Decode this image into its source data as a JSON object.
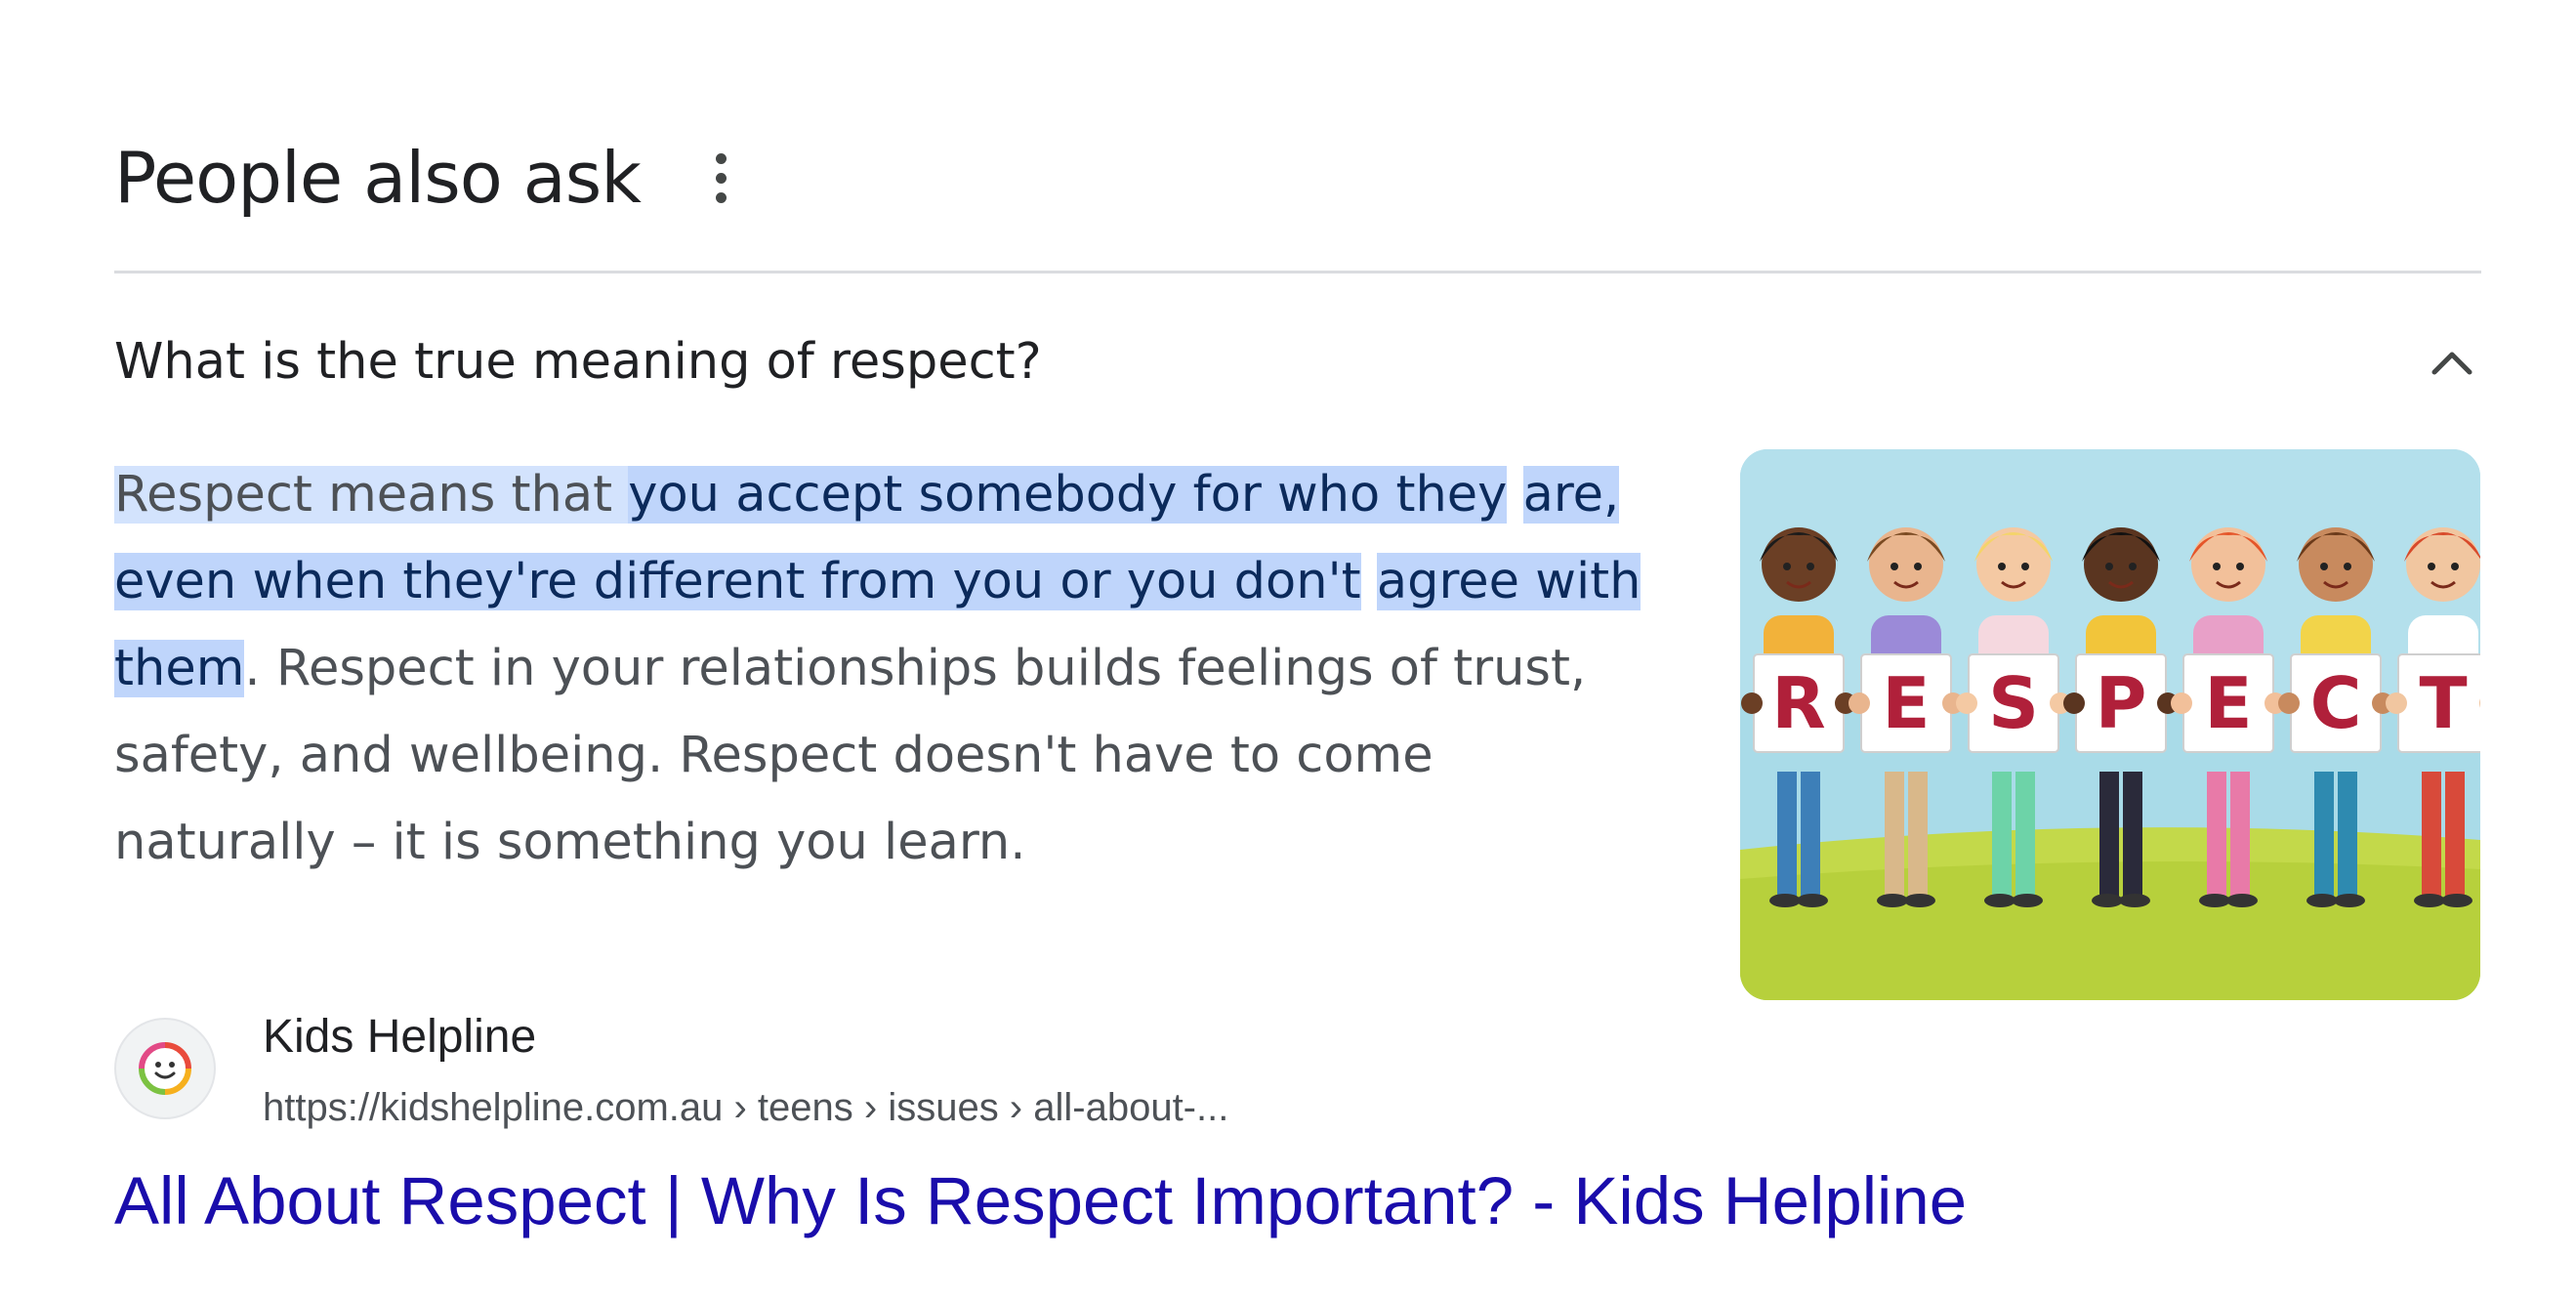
{
  "header": {
    "title": "People also ask",
    "more_icon": "more-vert-icon"
  },
  "question": {
    "text": "What is the true meaning of respect?",
    "toggle_icon": "chevron-up-icon",
    "expanded": true
  },
  "answer": {
    "part1": "Respect means that ",
    "part2a": "you accept somebody for who they",
    "part2b": "are, even when they're different from you or you don't",
    "part2c": "agree with them",
    "part3": ". Respect in your relationships builds feelings of trust, safety, and wellbeing. Respect doesn't have to come naturally – it is something you learn.",
    "image_letters": [
      "R",
      "E",
      "S",
      "P",
      "E",
      "C",
      "T"
    ]
  },
  "source": {
    "name": "Kids Helpline",
    "url": "https://kidshelpline.com.au › teens › issues › all-about-...",
    "favicon": "kids-helpline-logo-icon"
  },
  "result": {
    "title": "All About Respect | Why Is Respect Important? - Kids Helpline"
  },
  "colors": {
    "link": "#1a0dab",
    "highlight_light": "#d3e3fd",
    "highlight_strong": "#bfd5fb",
    "text_secondary": "#4d5156"
  }
}
